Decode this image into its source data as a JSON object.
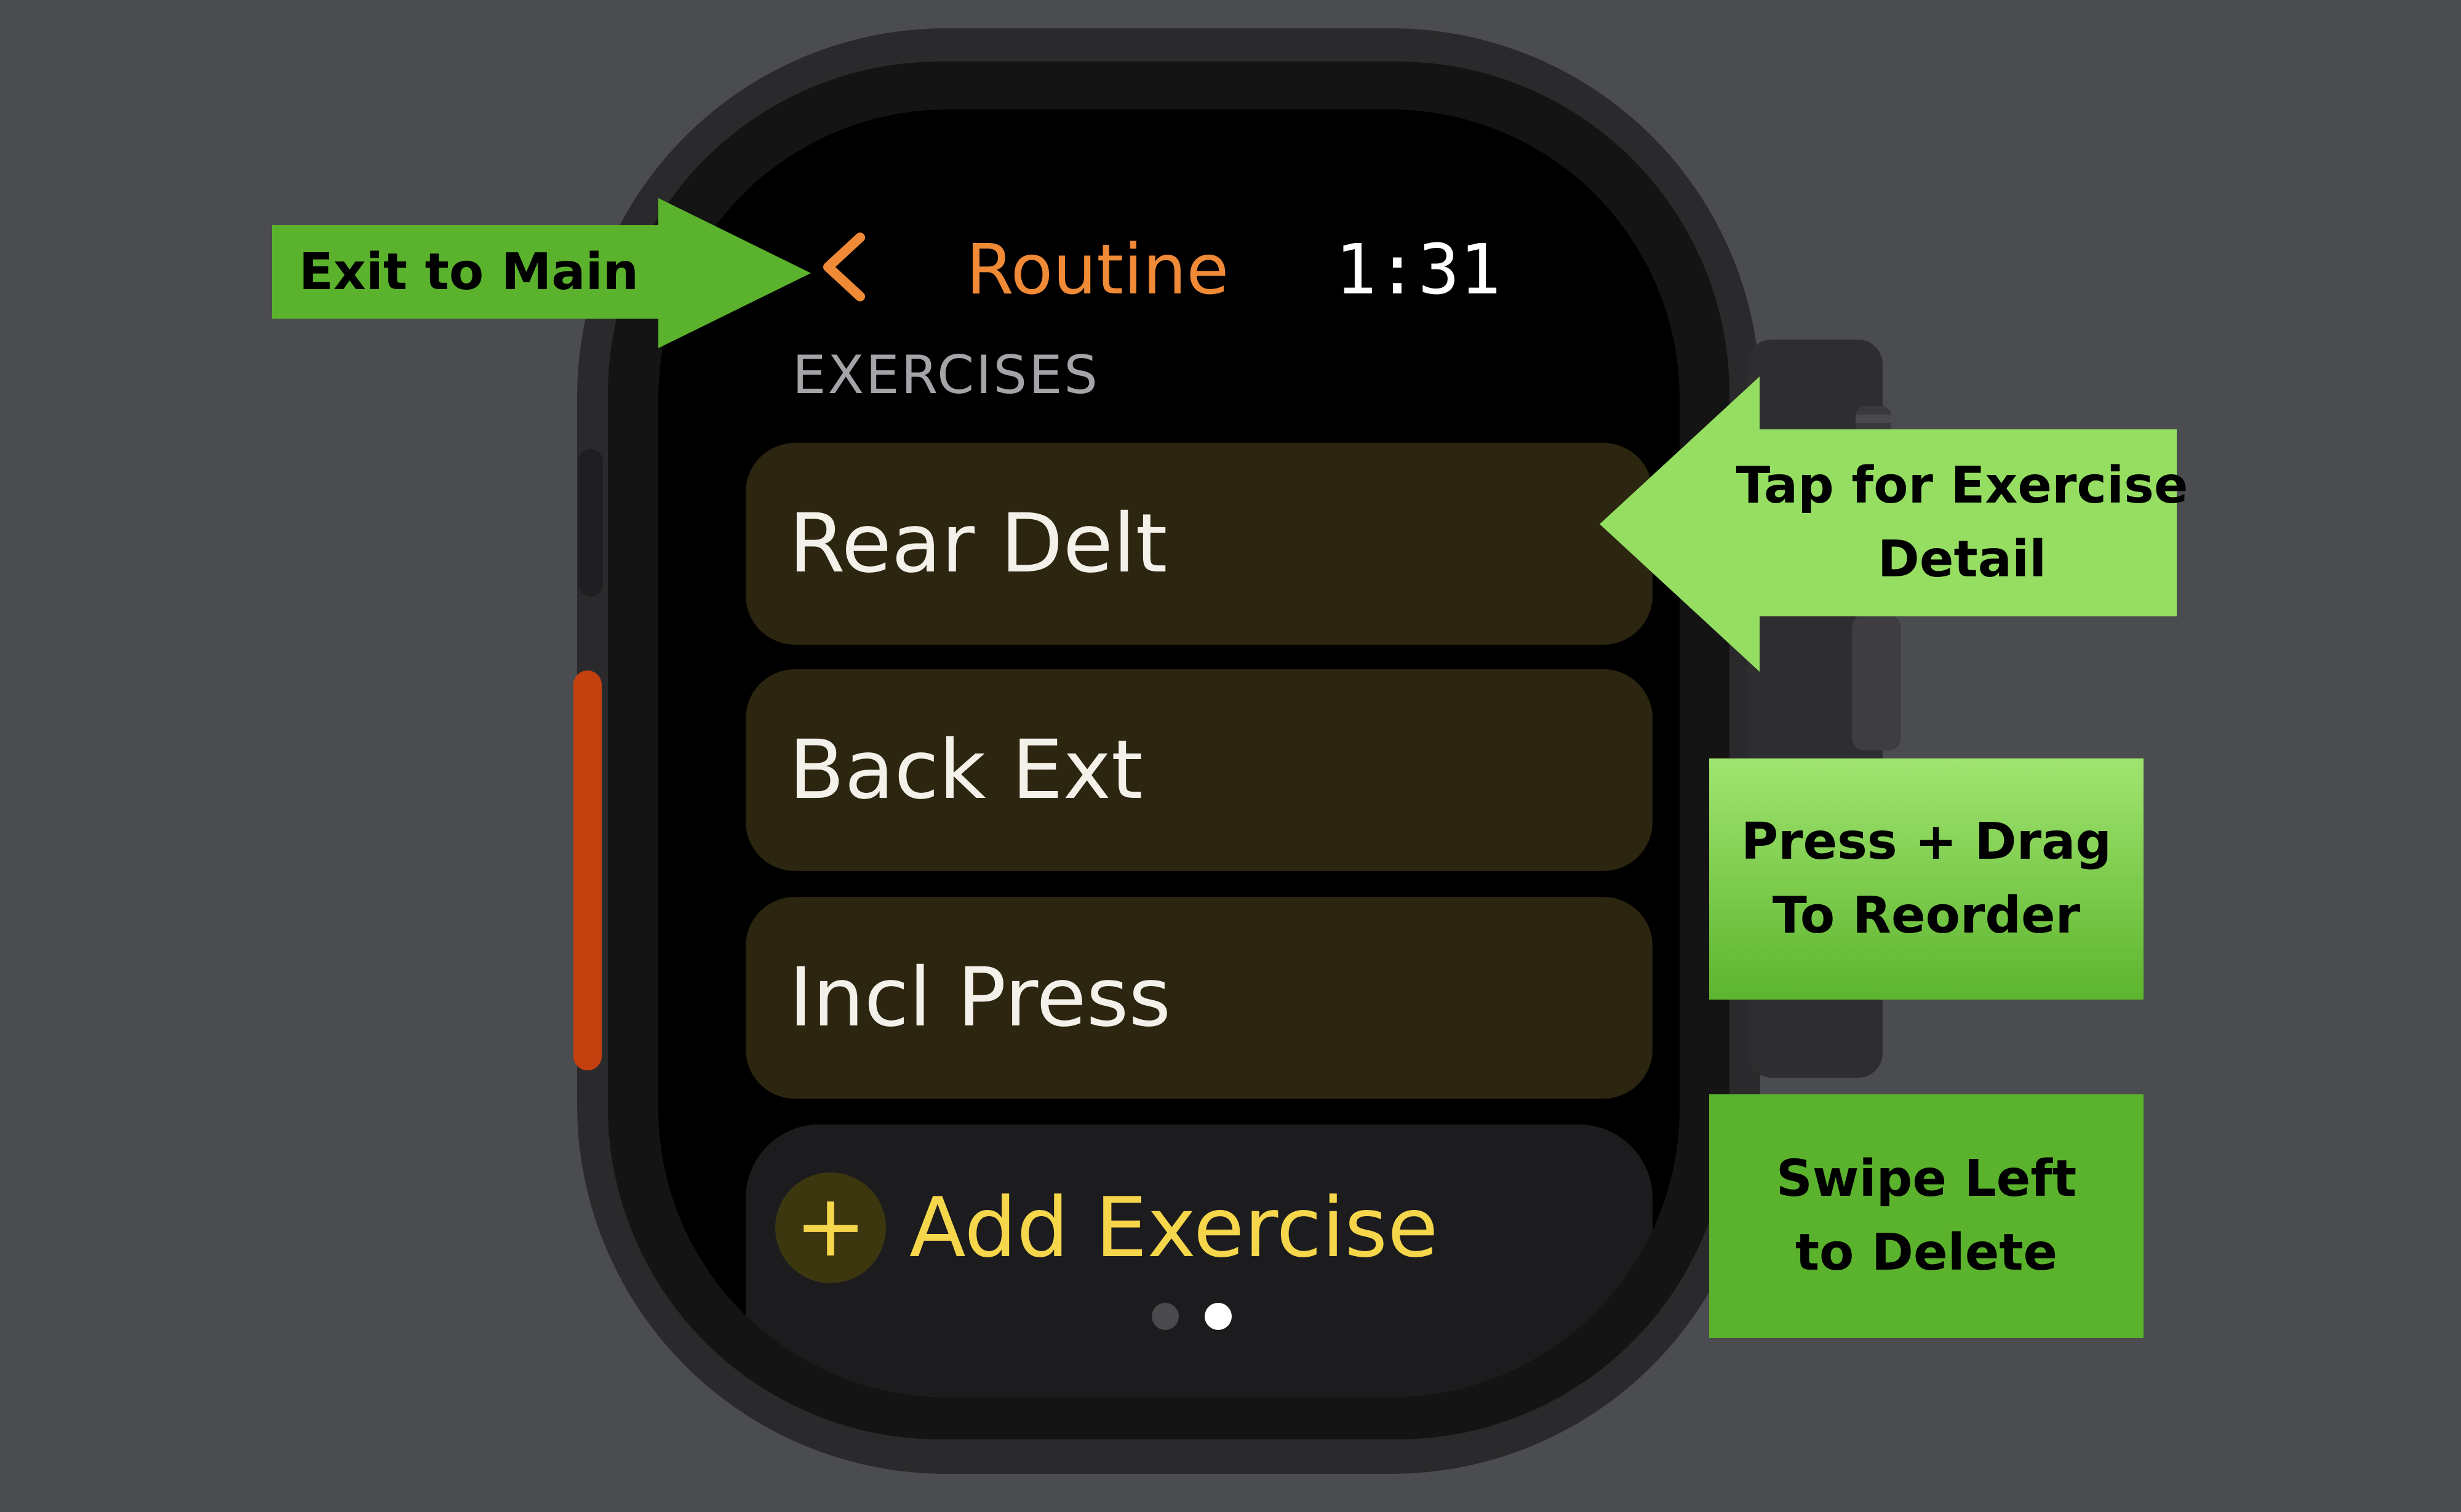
{
  "screen": {
    "nav": {
      "back_icon": "chevron-left-icon",
      "title": "Routine",
      "time": "1:31"
    },
    "section_header": "EXERCISES",
    "exercises": [
      {
        "label": "Rear Delt"
      },
      {
        "label": "Back Ext"
      },
      {
        "label": "Incl Press"
      }
    ],
    "add_button": {
      "icon": "plus-icon",
      "label": "Add Exercise"
    },
    "page_indicator": {
      "count": 2,
      "current": 2
    }
  },
  "annotations": {
    "exit": {
      "line1": "Exit to Main"
    },
    "tap": {
      "line1": "Tap for Exercise",
      "line2": "Detail"
    },
    "drag": {
      "line1": "Press + Drag",
      "line2": "To Reorder"
    },
    "swipe": {
      "line1": "Swipe Left",
      "line2": "to Delete"
    }
  },
  "colors": {
    "accent_orange": "#f08a36",
    "add_yellow": "#f6d64a",
    "row_background": "#2c2510",
    "callout_green": "#5bb22c",
    "callout_light_green": "#95de62",
    "page_background": "#4b4c50"
  }
}
